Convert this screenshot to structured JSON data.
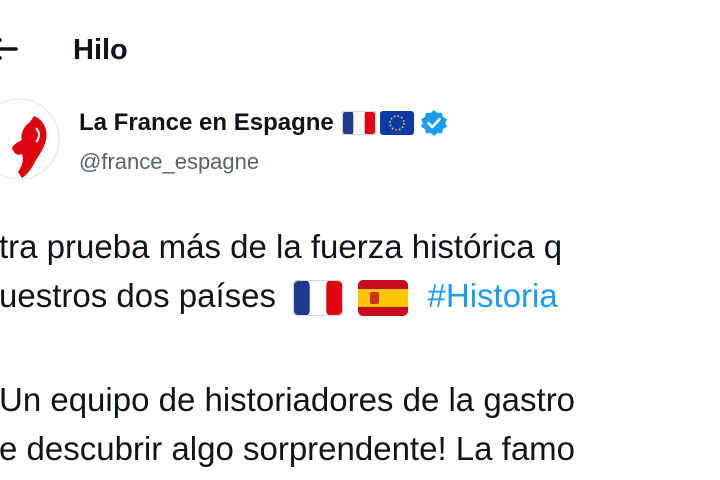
{
  "header": {
    "title": "Hilo"
  },
  "author": {
    "display_name": "La France en Espagne",
    "handle": "@france_espagne",
    "badges": [
      "france-flag-icon",
      "eu-flag-icon",
      "verified-badge-icon"
    ]
  },
  "tweet": {
    "line1": "tra prueba más de la fuerza histórica q",
    "line2": "uestros dos países",
    "hashtag": "#Historia",
    "line3": "Un equipo de historiadores de la gastro",
    "line4": "e descubrir algo sorprendente! La famo"
  },
  "colors": {
    "text": "#0f1419",
    "secondary": "#536471",
    "accent": "#1d9bf0",
    "verified": "#1d9bf0"
  }
}
